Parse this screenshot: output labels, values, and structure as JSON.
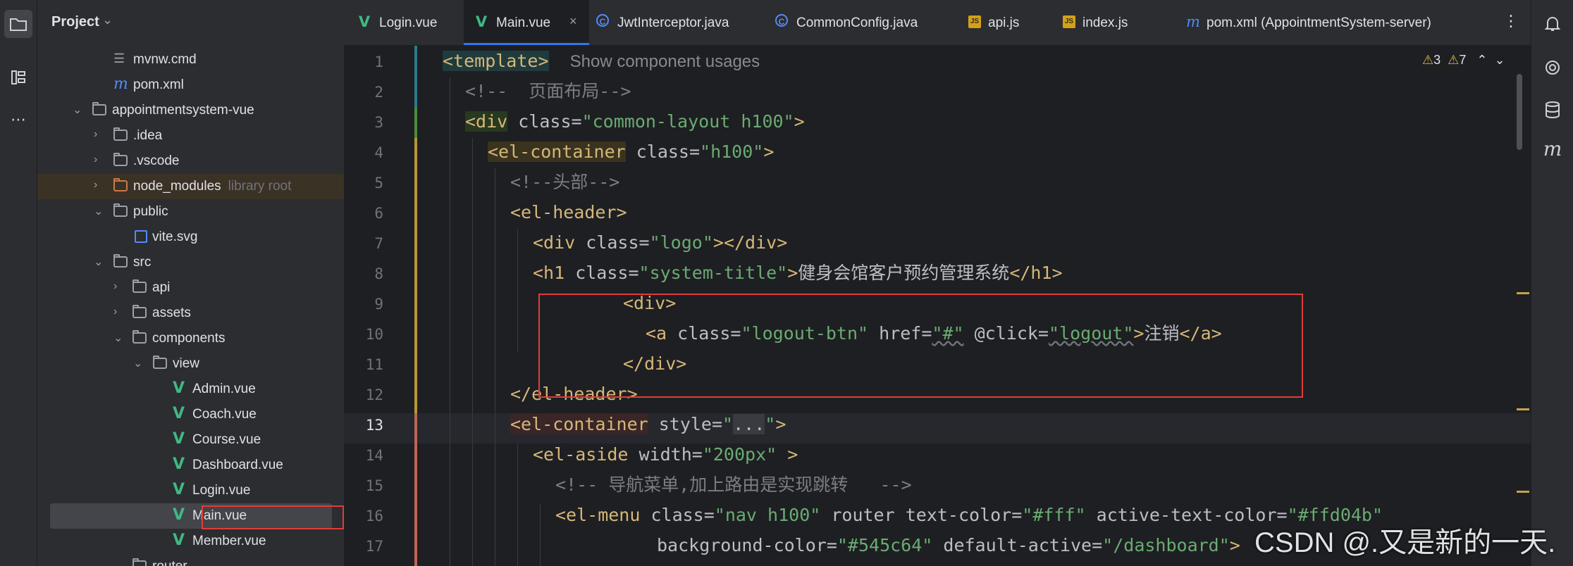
{
  "project_panel": {
    "title": "Project",
    "tree": [
      {
        "label": "mvnw.cmd",
        "icon": "lines-icon"
      },
      {
        "label": "pom.xml",
        "icon": "m-icon"
      },
      {
        "label": "appointmentsystem-vue",
        "icon": "folder-icon",
        "expanded": true
      },
      {
        "label": ".idea",
        "icon": "folder-icon",
        "expanded": false
      },
      {
        "label": ".vscode",
        "icon": "folder-icon",
        "expanded": false
      },
      {
        "label": "node_modules",
        "icon": "folder-icon",
        "expanded": false,
        "hint": "library root"
      },
      {
        "label": "public",
        "icon": "folder-icon",
        "expanded": true
      },
      {
        "label": "vite.svg",
        "icon": "svg-file-icon"
      },
      {
        "label": "src",
        "icon": "folder-icon",
        "expanded": true
      },
      {
        "label": "api",
        "icon": "folder-icon",
        "expanded": false
      },
      {
        "label": "assets",
        "icon": "folder-icon",
        "expanded": false
      },
      {
        "label": "components",
        "icon": "folder-icon",
        "expanded": true
      },
      {
        "label": "view",
        "icon": "folder-icon",
        "expanded": true
      },
      {
        "label": "Admin.vue",
        "icon": "vue-icon"
      },
      {
        "label": "Coach.vue",
        "icon": "vue-icon"
      },
      {
        "label": "Course.vue",
        "icon": "vue-icon"
      },
      {
        "label": "Dashboard.vue",
        "icon": "vue-icon"
      },
      {
        "label": "Login.vue",
        "icon": "vue-icon"
      },
      {
        "label": "Main.vue",
        "icon": "vue-icon",
        "selected": true
      },
      {
        "label": "Member.vue",
        "icon": "vue-icon"
      },
      {
        "label": "router",
        "icon": "folder-icon",
        "expanded": true
      }
    ]
  },
  "tabs": [
    {
      "label": "Login.vue",
      "icon": "vue-icon"
    },
    {
      "label": "Main.vue",
      "icon": "vue-icon",
      "active": true,
      "close": "×"
    },
    {
      "label": "JwtInterceptor.java",
      "icon": "class-icon"
    },
    {
      "label": "CommonConfig.java",
      "icon": "class-icon"
    },
    {
      "label": "api.js",
      "icon": "js-icon"
    },
    {
      "label": "index.js",
      "icon": "js-icon"
    },
    {
      "label": "pom.xml (AppointmentSystem-server)",
      "icon": "m-icon"
    }
  ],
  "editor": {
    "inspection": {
      "warnings_a": "3",
      "warnings_b": "7"
    },
    "current_line": 13,
    "line_numbers": [
      "1",
      "2",
      "3",
      "4",
      "5",
      "6",
      "7",
      "8",
      "9",
      "10",
      "11",
      "12",
      "13",
      "14",
      "15",
      "16",
      "17"
    ],
    "code": {
      "l1_tag": "<template>",
      "l1_hint": "Show component usages",
      "l2": "<!--  页面布局-->",
      "l3_open": "<div",
      "l3_attr": " class=",
      "l3_val": "\"common-layout h100\"",
      "l3_close": ">",
      "l4_open": "<el-container",
      "l4_attr": " class=",
      "l4_val": "\"h100\"",
      "l4_close": ">",
      "l5": "<!--头部-->",
      "l6": "<el-header>",
      "l7_open": "<div",
      "l7_attr": " class=",
      "l7_val": "\"logo\"",
      "l7_close": "></div>",
      "l8_open": "<h1",
      "l8_attr": " class=",
      "l8_val": "\"system-title\"",
      "l8_gt": ">",
      "l8_text": "健身会馆客户预约管理系统",
      "l8_close": "</h1>",
      "l9": "<div>",
      "l10_open": "<a",
      "l10_attr1": " class=",
      "l10_val1": "\"logout-btn\"",
      "l10_attr2": " href=",
      "l10_val2": "\"#\"",
      "l10_attr3": " @click=",
      "l10_val3": "\"logout\"",
      "l10_gt": ">",
      "l10_text": "注销",
      "l10_close": "</a>",
      "l11": "</div>",
      "l12": "</el-header>",
      "l13_open": "<el-container",
      "l13_attr": " style=",
      "l13_q1": "\"",
      "l13_fold": "...",
      "l13_q2": "\"",
      "l13_close": ">",
      "l14_open": "<el-aside",
      "l14_attr": " width=",
      "l14_val": "\"200px\"",
      "l14_close": " >",
      "l15": "<!-- 导航菜单,加上路由是实现跳转   -->",
      "l16_open": "<el-menu",
      "l16_attr1": " class=",
      "l16_val1": "\"nav h100\"",
      "l16_attr2": " router text-color=",
      "l16_val2": "\"#fff\"",
      "l16_attr3": " active-text-color=",
      "l16_val3": "\"#ffd04b\"",
      "l17_attr1": "background-color=",
      "l17_val1": "\"#545c64\"",
      "l17_attr2": " default-active=",
      "l17_val2": "\"/dashboard\"",
      "l17_close": ">"
    }
  },
  "watermark": "CSDN @.又是新的一天."
}
